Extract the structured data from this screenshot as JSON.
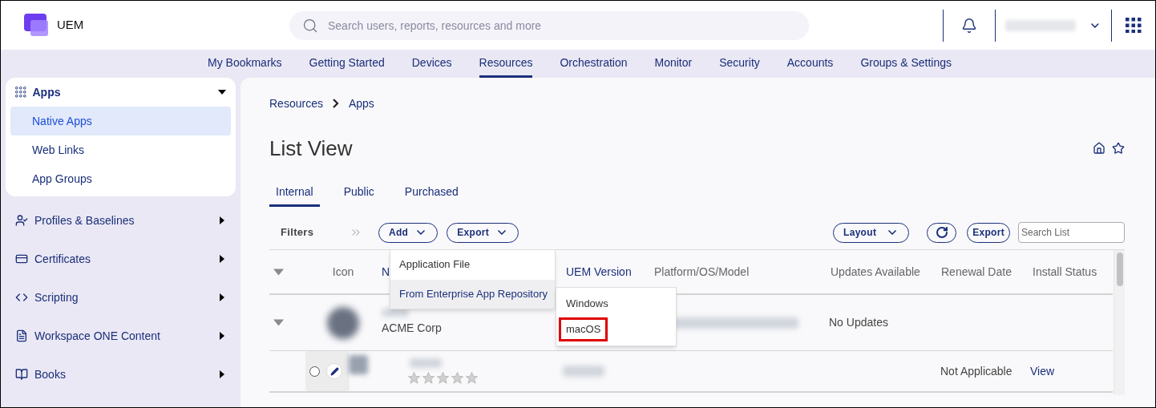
{
  "app": {
    "name": "UEM"
  },
  "search": {
    "placeholder": "Search users, reports, resources and more"
  },
  "nav": [
    {
      "label": "My Bookmarks",
      "selected": false
    },
    {
      "label": "Getting Started",
      "selected": false
    },
    {
      "label": "Devices",
      "selected": false
    },
    {
      "label": "Resources",
      "selected": true
    },
    {
      "label": "Orchestration",
      "selected": false
    },
    {
      "label": "Monitor",
      "selected": false
    },
    {
      "label": "Security",
      "selected": false
    },
    {
      "label": "Accounts",
      "selected": false
    },
    {
      "label": "Groups & Settings",
      "selected": false
    }
  ],
  "sidebar": {
    "groups": [
      {
        "label": "Apps",
        "kind": "apps",
        "expanded": true,
        "children": [
          {
            "label": "Native Apps",
            "selected": true
          },
          {
            "label": "Web Links",
            "selected": false
          },
          {
            "label": "App Groups",
            "selected": false
          }
        ]
      },
      {
        "label": "Profiles & Baselines",
        "kind": "profiles",
        "expanded": false
      },
      {
        "label": "Certificates",
        "kind": "certificates",
        "expanded": false
      },
      {
        "label": "Scripting",
        "kind": "scripting",
        "expanded": false
      },
      {
        "label": "Workspace ONE Content",
        "kind": "content",
        "expanded": false
      },
      {
        "label": "Books",
        "kind": "books",
        "expanded": false
      }
    ]
  },
  "breadcrumb": [
    "Resources",
    "Apps"
  ],
  "title": "List View",
  "tabs": [
    {
      "label": "Internal",
      "selected": true
    },
    {
      "label": "Public",
      "selected": false
    },
    {
      "label": "Purchased",
      "selected": false
    }
  ],
  "toolbar": {
    "filters": "Filters",
    "menu_buttons": [
      "Add",
      "Export"
    ],
    "layout": "Layout",
    "export": "Export",
    "search_placeholder": "Search List"
  },
  "table": {
    "expanded": true,
    "columns": [
      {
        "label": "Icon",
        "kind": "plain"
      },
      {
        "label": "N",
        "kind": "link"
      },
      {
        "label": "UEM Version",
        "kind": "link"
      },
      {
        "label": "Platform/OS/Model",
        "kind": "plain"
      },
      {
        "label": "Updates Available",
        "kind": "plain"
      },
      {
        "label": "Renewal Date",
        "kind": "plain"
      },
      {
        "label": "Install Status",
        "kind": "plain"
      }
    ],
    "rows": [
      {
        "kind": "app",
        "expanded": true,
        "publisher": "ACME Corp",
        "updates": "No Updates"
      },
      {
        "kind": "version",
        "selected": false,
        "stars": 0,
        "renewal": "Not Applicable",
        "install": "View"
      }
    ]
  },
  "add_menu": {
    "items": [
      {
        "label": "Application File",
        "selected": false
      },
      {
        "label": "From Enterprise App Repository",
        "selected": true
      }
    ]
  },
  "submenu": {
    "items": [
      {
        "label": "Windows",
        "highlighted": false
      },
      {
        "label": "macOS",
        "highlighted": true
      }
    ]
  }
}
